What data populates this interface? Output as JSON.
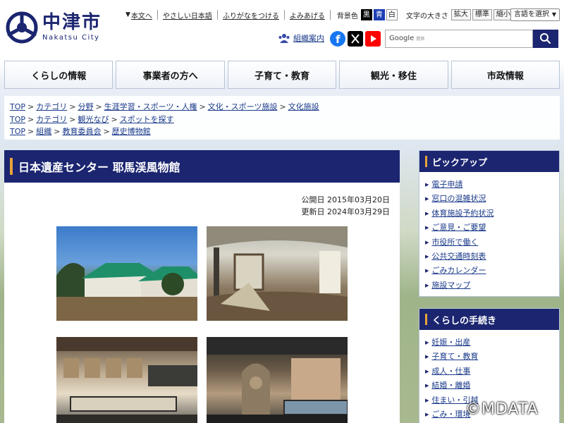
{
  "logo": {
    "jp": "中津市",
    "en": "Nakatsu City"
  },
  "util": {
    "skip": "本文へ",
    "easy_jp": "やさしい日本語",
    "furigana": "ふりがなをつける",
    "read": "よみあげる",
    "bg_label": "背景色",
    "bg_black": "黒",
    "bg_blue": "青",
    "bg_white": "白",
    "font_label": "文字の大きさ",
    "font_large": "拡大",
    "font_std": "標準",
    "font_small": "縮小",
    "lang": "言語を選択"
  },
  "org_link": "組織案内",
  "search": {
    "brand": "Google",
    "brand_sub": "提供",
    "placeholder": ""
  },
  "nav": [
    "くらしの情報",
    "事業者の方へ",
    "子育て・教育",
    "観光・移住",
    "市政情報"
  ],
  "breadcrumbs": [
    [
      "TOP",
      "カテゴリ",
      "分野",
      "生涯学習・スポーツ・人権",
      "文化・スポーツ施設",
      "文化施設"
    ],
    [
      "TOP",
      "カテゴリ",
      "観光なび",
      "スポットを探す"
    ],
    [
      "TOP",
      "組織",
      "教育委員会",
      "歴史博物館"
    ]
  ],
  "page": {
    "title": "日本遺産センター 耶馬渓風物館",
    "published": "公開日 2015年03月20日",
    "updated": "更新日 2024年03月29日"
  },
  "sidebar": {
    "pickup": {
      "title": "ピックアップ",
      "items": [
        "電子申請",
        "窓口の混雑状況",
        "体育施設予約状況",
        "ご意見・ご要望",
        "市役所で働く",
        "公共交通時刻表",
        "ごみカレンダー",
        "施設マップ"
      ]
    },
    "procedures": {
      "title": "くらしの手続き",
      "items": [
        "妊娠・出産",
        "子育て・教育",
        "成人・仕事",
        "結婚・離婚",
        "住まい・引越",
        "ごみ・環境"
      ]
    }
  },
  "copyright": "©MDATA",
  "colors": {
    "brand": "#1b2570",
    "accent": "#e8a33a"
  }
}
